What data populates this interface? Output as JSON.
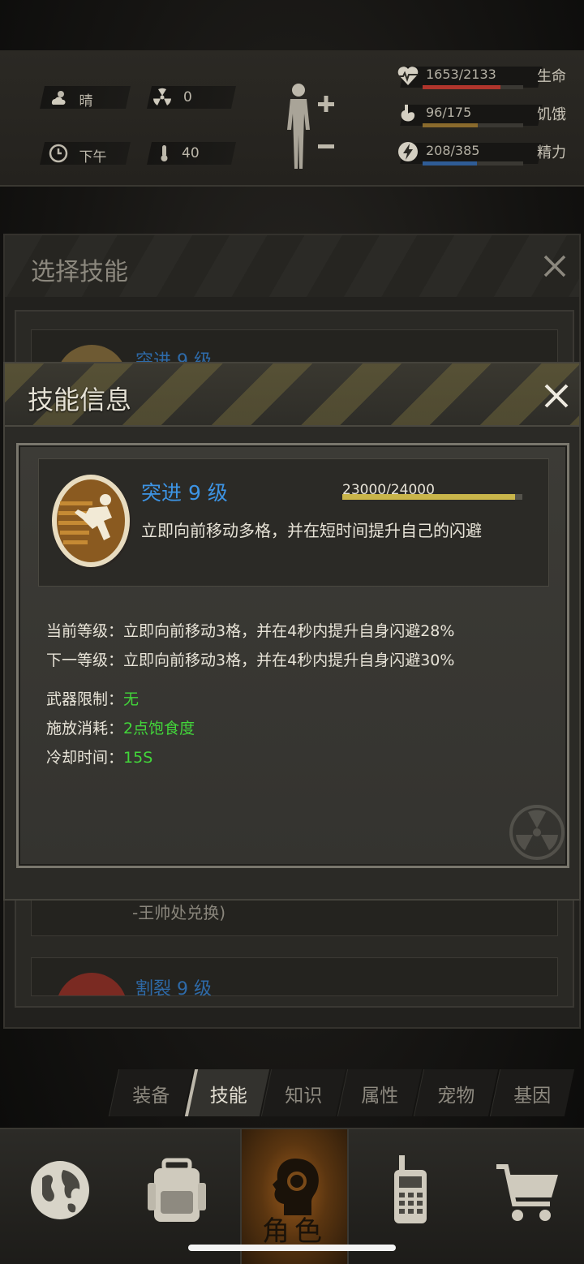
{
  "hud": {
    "weather": "晴",
    "radiation": "0",
    "time_of_day": "下午",
    "temperature": "40",
    "stats": [
      {
        "label": "生命",
        "value": "1653/2133",
        "fraction": 0.775,
        "color": "#b0352c",
        "icon": "heart-icon"
      },
      {
        "label": "饥饿",
        "value": "96/175",
        "fraction": 0.549,
        "color": "#8a6a2c",
        "icon": "stomach-icon"
      },
      {
        "label": "精力",
        "value": "208/385",
        "fraction": 0.54,
        "color": "#2f5c96",
        "icon": "energy-icon"
      }
    ]
  },
  "under_panel": {
    "title": "选择技能",
    "items": [
      {
        "name": "突进 9 级"
      },
      {
        "desc": "-王帅处兑换)"
      },
      {
        "name": "割裂 9 级"
      }
    ]
  },
  "modal": {
    "title": "技能信息",
    "skill": {
      "name": "突进 9 级",
      "exp_text": "23000/24000",
      "exp_fraction": 0.958,
      "description": "立即向前移动多格，并在短时间提升自己的闪避"
    },
    "current_level": {
      "label": "当前等级：",
      "text": "立即向前移动3格，并在4秒内提升自身闪避28%"
    },
    "next_level": {
      "label": "下一等级：",
      "text": "立即向前移动3格，并在4秒内提升自身闪避30%"
    },
    "weapon_limit": {
      "label": "武器限制：",
      "value": "无"
    },
    "cast_cost": {
      "label": "施放消耗：",
      "value": "2点饱食度"
    },
    "cooldown": {
      "label": "冷却时间：",
      "value": "15S"
    }
  },
  "tabs": [
    "装备",
    "技能",
    "知识",
    "属性",
    "宠物",
    "基因"
  ],
  "active_tab": "技能",
  "bottom_nav": {
    "items": [
      "globe-icon",
      "backpack-icon",
      "character-icon",
      "walkie-talkie-icon",
      "cart-icon"
    ],
    "active_label": "角色"
  },
  "colors": {
    "accent_blue": "#3d94e4",
    "value_green": "#42d63a",
    "exp_gold": "#c9b54a"
  }
}
